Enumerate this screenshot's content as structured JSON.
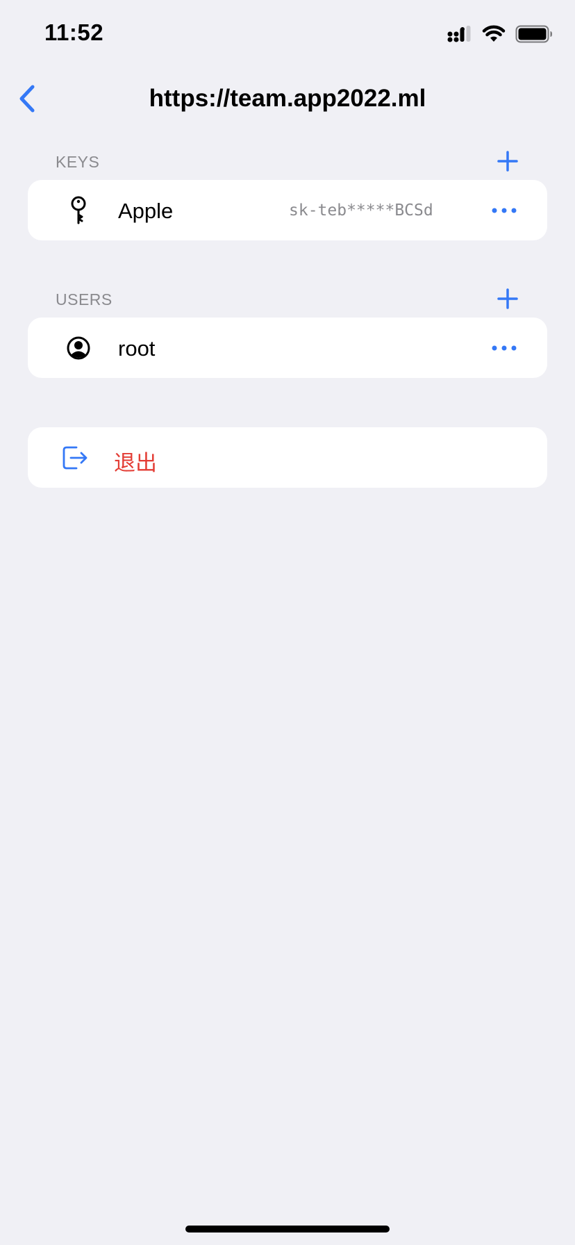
{
  "status_bar": {
    "time": "11:52",
    "icons": [
      "cellular-signal-icon",
      "wifi-icon",
      "battery-icon"
    ]
  },
  "nav": {
    "back_icon": "chevron-left-icon",
    "title": "https://team.app2022.ml"
  },
  "keys_section": {
    "header": "KEYS",
    "add_icon": "plus-icon",
    "items": [
      {
        "icon": "key-icon",
        "name": "Apple",
        "key": "sk-teb*****BCSd",
        "more_icon": "ellipsis-icon"
      }
    ]
  },
  "users_section": {
    "header": "USERS",
    "add_icon": "plus-icon",
    "items": [
      {
        "icon": "person-circle-icon",
        "name": "root",
        "more_icon": "ellipsis-icon"
      }
    ]
  },
  "logout": {
    "icon": "logout-icon",
    "label": "退出"
  },
  "colors": {
    "accent": "#3478f6",
    "destructive": "#e33d35",
    "background": "#f0f0f5",
    "card": "#ffffff",
    "secondary_text": "#8a8a8e"
  }
}
